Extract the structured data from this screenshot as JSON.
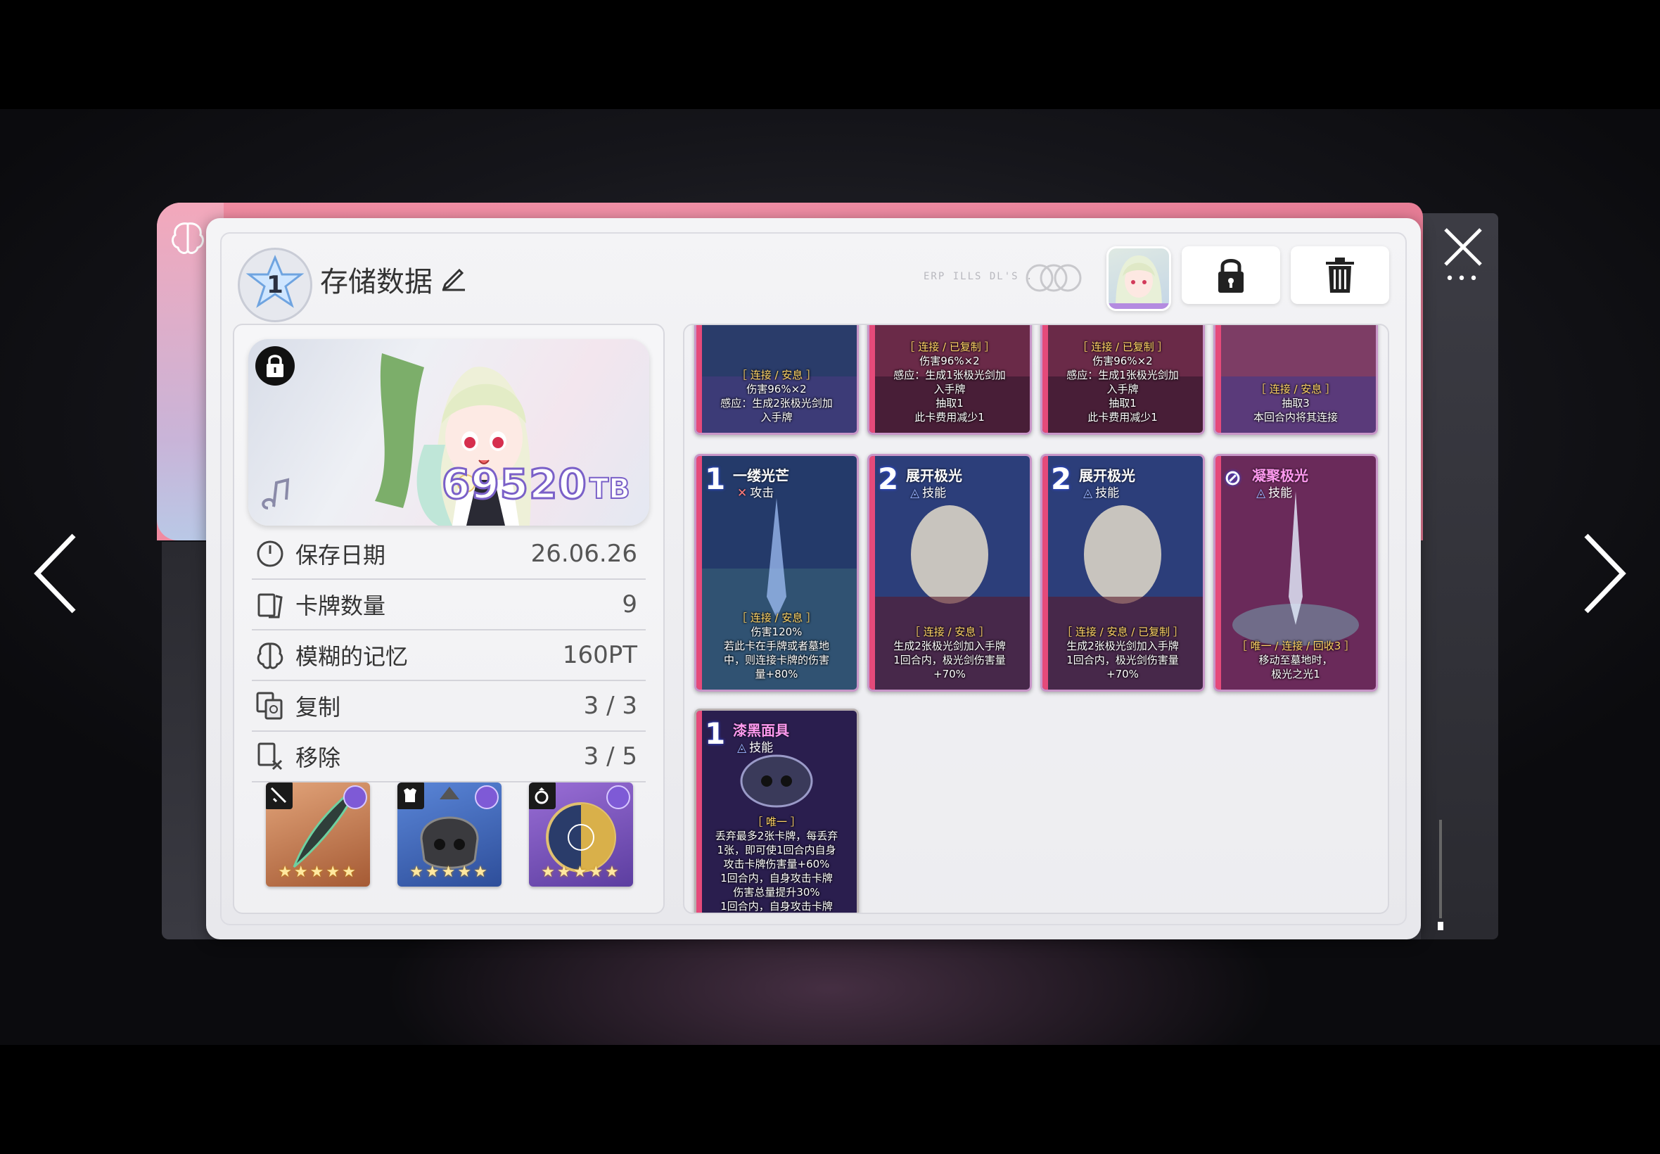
{
  "header": {
    "level": "1",
    "title": "存储数据",
    "deco_text": "ERP ILLS DL'S .",
    "lock_label": "lock",
    "trash_label": "delete"
  },
  "hero": {
    "score": "69520",
    "unit": "TB"
  },
  "stats": [
    {
      "icon": "clock-icon",
      "label": "保存日期",
      "value": "26.06.26"
    },
    {
      "icon": "cards-icon",
      "label": "卡牌数量",
      "value": "9"
    },
    {
      "icon": "brain-icon",
      "label": "模糊的记忆",
      "value": "160PT"
    },
    {
      "icon": "copy-icon",
      "label": "复制",
      "value": "3 / 3"
    },
    {
      "icon": "remove-icon",
      "label": "移除",
      "value": "3 / 5"
    }
  ],
  "equipment": [
    {
      "slot": "weapon",
      "icon": "sword-icon",
      "stars": "★★★★★",
      "color": "#c77a4a"
    },
    {
      "slot": "armor",
      "icon": "armor-icon",
      "stars": "★★★★★",
      "color": "#3f64b8"
    },
    {
      "slot": "ring",
      "icon": "ring-icon",
      "stars": "★★★★★",
      "color": "#8a5bc4"
    }
  ],
  "cards_row0": [
    {
      "keyword": "［ 连接 / 安息 ］",
      "lines": [
        "伤害96%×2",
        "感应：生成2张极光剑加",
        "入手牌"
      ]
    },
    {
      "keyword": "［ 连接 / 已复制 ］",
      "lines": [
        "伤害96%×2",
        "感应：生成1张极光剑加",
        "入手牌",
        "抽取1",
        "此卡费用减少1"
      ]
    },
    {
      "keyword": "［ 连接 / 已复制 ］",
      "lines": [
        "伤害96%×2",
        "感应：生成1张极光剑加",
        "入手牌",
        "抽取1",
        "此卡费用减少1"
      ]
    },
    {
      "keyword": "［ 连接 / 安息 ］",
      "lines": [
        "抽取3",
        "本回合内将其连接"
      ]
    }
  ],
  "cards_row1": [
    {
      "cost": "1",
      "name": "一缕光芒",
      "type": "攻击",
      "keyword": "［ 连接 / 安息 ］",
      "lines": [
        "伤害120%",
        "若此卡在手牌或者墓地",
        "中，则连接卡牌的伤害",
        "量+80%"
      ]
    },
    {
      "cost": "2",
      "name": "展开极光",
      "type": "技能",
      "keyword": "［ 连接 / 安息 ］",
      "lines": [
        "生成2张极光剑加入手牌",
        "1回合内，极光剑伤害量",
        "+70%"
      ]
    },
    {
      "cost": "2",
      "name": "展开极光",
      "type": "技能",
      "keyword": "［ 连接 / 安息 / 已复制 ］",
      "lines": [
        "生成2张极光剑加入手牌",
        "1回合内，极光剑伤害量",
        "+70%"
      ]
    },
    {
      "cost": "",
      "name": "凝聚极光",
      "type": "技能",
      "keyword": "［ 唯一 / 连接 / 回收3 ］",
      "lines": [
        "移动至墓地时，",
        "极光之光1"
      ]
    }
  ],
  "cards_row2": [
    {
      "cost": "1",
      "name": "漆黑面具",
      "type": "技能",
      "keyword": "［ 唯一 ］",
      "lines": [
        "丢弃最多2张卡牌，每丢弃",
        "1张，即可使1回合内自身",
        "攻击卡牌伤害量+60%",
        "1回合内，自身攻击卡牌",
        "伤害总量提升30%",
        "1回合内，自身攻击卡牌"
      ]
    }
  ]
}
